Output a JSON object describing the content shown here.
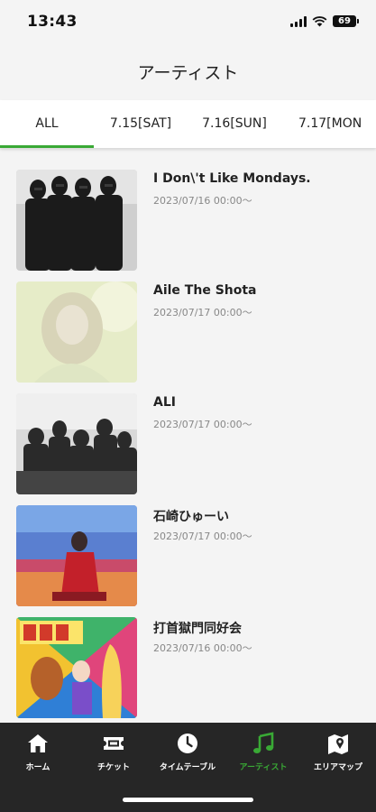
{
  "status_bar": {
    "time": "13:43",
    "battery": "69"
  },
  "header": {
    "title": "アーティスト"
  },
  "tabs": [
    {
      "label": "ALL",
      "active": true
    },
    {
      "label": "7.15[SAT]"
    },
    {
      "label": "7.16[SUN]"
    },
    {
      "label": "7.17[MON"
    }
  ],
  "artists": [
    {
      "name": "I Don\\'t Like Mondays.",
      "date": "2023/07/16 00:00〜"
    },
    {
      "name": "Aile The Shota",
      "date": "2023/07/17 00:00〜"
    },
    {
      "name": "ALI",
      "date": "2023/07/17 00:00〜"
    },
    {
      "name": "石崎ひゅーい",
      "date": "2023/07/17 00:00〜"
    },
    {
      "name": "打首獄門同好会",
      "date": "2023/07/16 00:00〜"
    }
  ],
  "bottom_nav": [
    {
      "label": "ホーム",
      "icon": "home-icon"
    },
    {
      "label": "チケット",
      "icon": "ticket-icon"
    },
    {
      "label": "タイムテーブル",
      "icon": "clock-icon"
    },
    {
      "label": "アーティスト",
      "icon": "music-note-icon",
      "active": true
    },
    {
      "label": "エリアマップ",
      "icon": "map-icon"
    }
  ],
  "colors": {
    "accent": "#39a935",
    "nav_background": "#262626",
    "page_background": "#f4f4f4"
  }
}
